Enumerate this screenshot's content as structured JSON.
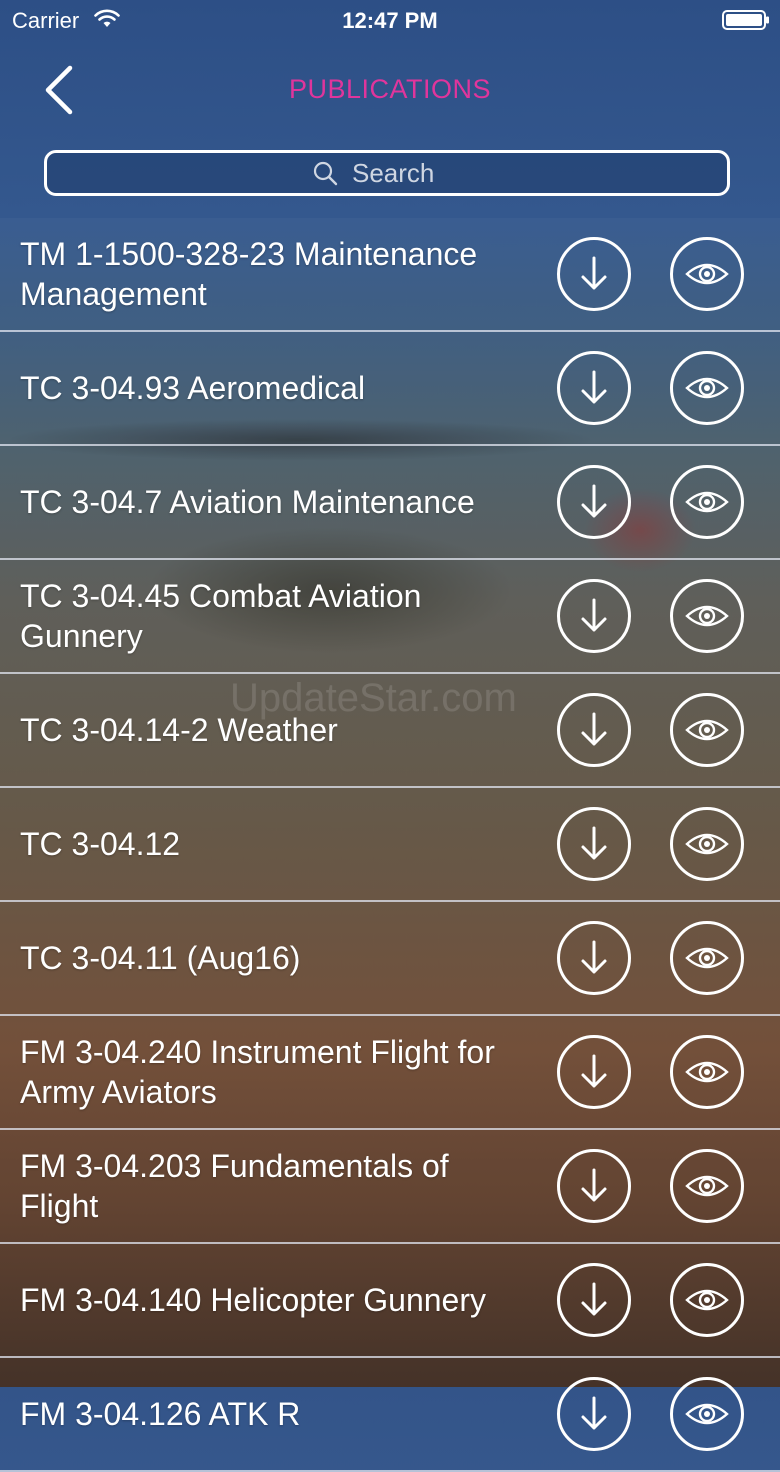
{
  "status_bar": {
    "carrier": "Carrier",
    "time": "12:47 PM"
  },
  "nav": {
    "title": "PUBLICATIONS",
    "title_color": "#e0359c",
    "back_icon": "chevron-left-icon"
  },
  "search": {
    "placeholder": "Search",
    "value": ""
  },
  "watermark": "UpdateStar.com",
  "publications": [
    {
      "title": "TM 1-1500-328-23 Maintenance Management"
    },
    {
      "title": "TC 3-04.93 Aeromedical"
    },
    {
      "title": "TC 3-04.7 Aviation Maintenance"
    },
    {
      "title": "TC 3-04.45 Combat Aviation Gunnery"
    },
    {
      "title": "TC 3-04.14-2 Weather"
    },
    {
      "title": "TC 3-04.12"
    },
    {
      "title": "TC 3-04.11 (Aug16)"
    },
    {
      "title": "FM 3-04.240 Instrument Flight for Army Aviators"
    },
    {
      "title": "FM 3-04.203 Fundamentals of Flight"
    },
    {
      "title": "FM 3-04.140 Helicopter Gunnery"
    },
    {
      "title": "FM 3-04.126 ATK R"
    }
  ],
  "row_actions": {
    "download_icon": "download-arrow-icon",
    "view_icon": "eye-icon"
  }
}
